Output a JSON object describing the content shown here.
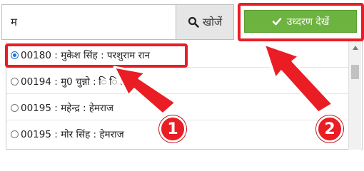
{
  "search": {
    "value": "म",
    "button_label": "खोजें",
    "button_icon": "search-icon"
  },
  "view_button": {
    "label": "उध्दरण देखें",
    "icon": "check-icon",
    "color": "#6db33f"
  },
  "results": [
    {
      "text": "00180 : मुकेश सिंह : परशुराम रान",
      "selected": true
    },
    {
      "text": "00194 : मु0 चुन्नो : ि ि ि",
      "selected": false
    },
    {
      "text": "00195 : महेन्द्र : हेमराज",
      "selected": false
    },
    {
      "text": "00195 : मोर सिंह : हेमराज",
      "selected": false
    }
  ],
  "annotations": {
    "badge1": "1",
    "badge2": "2",
    "highlight_color": "#ea1c24"
  }
}
